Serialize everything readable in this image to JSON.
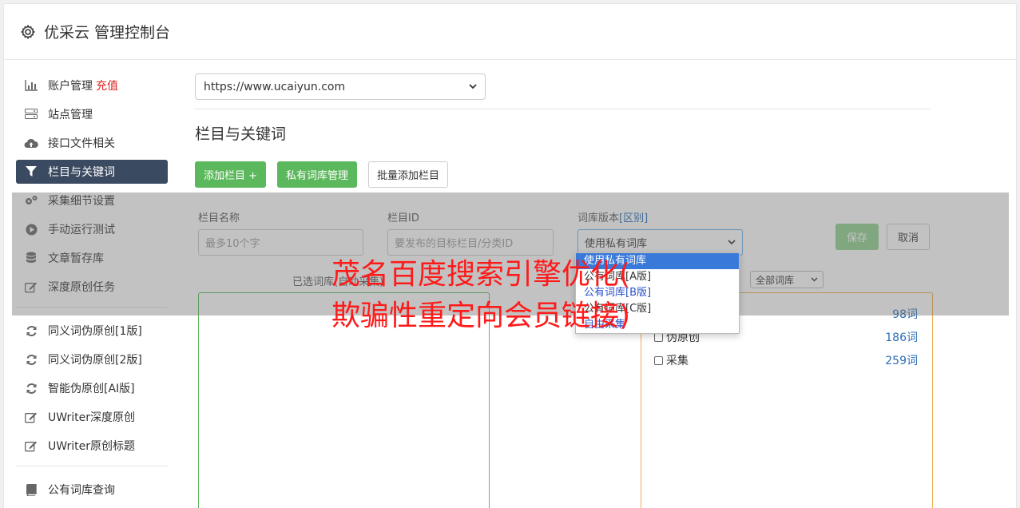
{
  "header": {
    "title": "优采云 管理控制台"
  },
  "sidebar": {
    "items": [
      {
        "label": "账户管理",
        "badge": "充值",
        "icon": "bar-chart-icon"
      },
      {
        "label": "站点管理",
        "icon": "server-icon"
      },
      {
        "label": "接口文件相关",
        "icon": "cloud-upload-icon"
      },
      {
        "label": "栏目与关键词",
        "icon": "filter-icon",
        "active": true
      },
      {
        "label": "采集细节设置",
        "icon": "gears-icon"
      },
      {
        "label": "手动运行测试",
        "icon": "play-icon"
      },
      {
        "label": "文章暂存库",
        "icon": "database-icon"
      },
      {
        "label": "深度原创任务",
        "icon": "edit-icon"
      }
    ],
    "items2": [
      {
        "label": "同义词伪原创[1版]",
        "icon": "refresh-icon"
      },
      {
        "label": "同义词伪原创[2版]",
        "icon": "refresh-icon"
      },
      {
        "label": "智能伪原创[AI版]",
        "icon": "refresh-icon"
      },
      {
        "label": "UWriter深度原创",
        "icon": "edit-icon"
      },
      {
        "label": "UWriter原创标题",
        "icon": "edit-icon"
      }
    ],
    "items3": [
      {
        "label": "公有词库查询",
        "icon": "book-icon"
      }
    ]
  },
  "main": {
    "site_select": "https://www.ucaiyun.com",
    "section_title": "栏目与关键词",
    "buttons": {
      "add": "添加栏目 +",
      "private": "私有词库管理",
      "batch": "批量添加栏目"
    },
    "form": {
      "name_label": "栏目名称",
      "name_placeholder": "最多10个字",
      "id_label": "栏目ID",
      "id_placeholder": "要发布的目标栏目/分类ID",
      "version_label": "词库版本",
      "version_link": "[区别]",
      "version_value": "使用私有词库",
      "save": "保存",
      "cancel": "取消"
    },
    "dropdown_options": [
      "使用私有词库",
      "公有词库[A版]",
      "公有词库[B版]",
      "公有词库[C版]",
      "自由采集"
    ],
    "selected_label": "已选词库(自动采集)",
    "filter": "全部词库",
    "libraries": [
      {
        "name": "",
        "count": "98词"
      },
      {
        "name": "伪原创",
        "count": "186词"
      },
      {
        "name": "采集",
        "count": "259词"
      }
    ]
  },
  "watermark": {
    "line1": "茂名百度搜索引擎优化(",
    "line2": "欺骗性重定向会员链接)"
  },
  "colors": {
    "active_nav": "#3a4a60",
    "green": "#5cb85c",
    "badge": "#e02020",
    "watermark": "#ff1a1a"
  }
}
